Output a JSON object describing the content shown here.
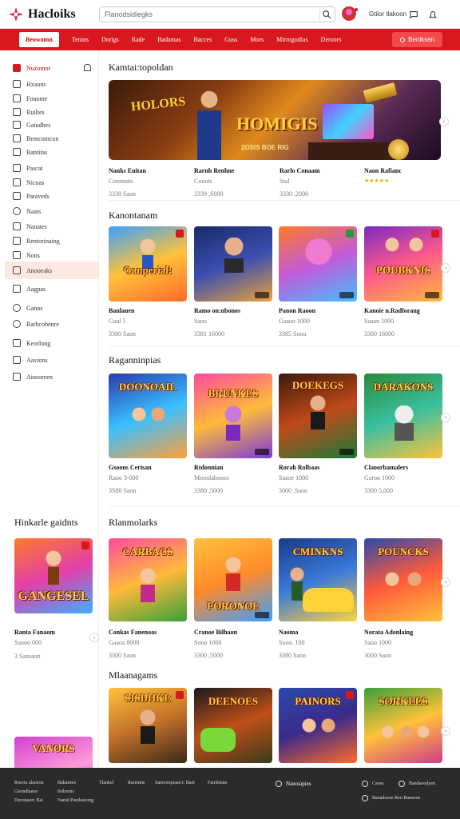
{
  "topbar": {
    "logo_text": "Hacloiks",
    "search_placeholder": "Flanodsidiegks",
    "user_name": "Gtiior tlakoon"
  },
  "nav": {
    "items": [
      "Beowomn",
      "Tenins",
      "Dorigs",
      "Rade",
      "Badamas",
      "Bacces",
      "Guss",
      "Mors",
      "Mirrogodias",
      "Deroors"
    ],
    "button_label": "Benlksen"
  },
  "sidebar": {
    "items": [
      "Nuzomor",
      "Hxaons",
      "Fouome",
      "Ruiltes",
      "Gatudhes",
      "Bemcomcon",
      "Bantitas",
      "Pascat",
      "Nicoas",
      "Paraveds",
      "Naats",
      "Nanates",
      "Rentorinaing",
      "Nons",
      "Anooeaks",
      "Aagpas",
      "Ganos",
      "Rarbcobenre",
      "Keorlong",
      "Aavions",
      "Ainsoreen"
    ]
  },
  "sections": {
    "s1": "Kamtai:topoldan",
    "s2": "Kanontanam",
    "s3": "Raganninpias",
    "s4": "Rlanmolarks",
    "s5": "Mlaanagams",
    "side": "Hinkarle gaidnts"
  },
  "banner": {
    "logo": "HOLORS",
    "title": "HOMIGIS",
    "subtitle": "2OSIS BOE RIG"
  },
  "info1": [
    {
      "t": "Nanks Enitan",
      "s": "Coronuto",
      "s2": "3338 Saon"
    },
    {
      "t": "Rarnh Renhne",
      "s": "Conots",
      "s2": "3339 ,S000"
    },
    {
      "t": "Rarlo Conaam",
      "s": "Stal",
      "s2": "3330 .2000"
    },
    {
      "t": "Naon Rafianc",
      "stars": "★★★★★"
    }
  ],
  "row2": [
    {
      "title": "Ganperial!",
      "t": "Banlauen",
      "s": "Gaul 5",
      "s2": "3380 Saon"
    },
    {
      "title": "",
      "t": "Ramo on:nbonos",
      "s": "Saoo",
      "s2": "3381 16000"
    },
    {
      "title": "",
      "t": "Panon Raoon",
      "s": "Gaaoo 1000",
      "s2": "3385 Sooo"
    },
    {
      "title": "POUBKNIS",
      "t": "Kanoie n.Radforang",
      "s": "Saaan 1000",
      "s2": "3380 16000"
    }
  ],
  "row3": [
    {
      "title": "DOONOAIL",
      "t": "Gsoons Cerisan",
      "s": "Raoo 3-000",
      "s2": "3S80 Saon"
    },
    {
      "title": "BRUNKES",
      "t": "Rtdonnian",
      "s": "Moonlabooso",
      "s2": "3380 ,5000"
    },
    {
      "title": "DOEKEGS",
      "t": "Rorah Rolbaas",
      "s": "Saaoe 1000",
      "s2": "3000 .Saon"
    },
    {
      "title": "DARAKONS",
      "t": "Claoorbamalers",
      "s": "Garon 1000",
      "s2": "3300 5,000"
    }
  ],
  "row4": [
    {
      "title": "GANGESEL",
      "t": "Ranta Fanaom",
      "s": "Sanoo 000",
      "s2": "3 Sansaon"
    },
    {
      "title": "CARBACS",
      "t": "Conkas Fanenoas",
      "s": "Gaaoa 8000",
      "s2": "3300 Saon"
    },
    {
      "title": "FORONOE",
      "t": "Cranoe Bilhaon",
      "s": "Sooo 1000",
      "s2": "3300 ,5000"
    },
    {
      "title": "CMINKNS",
      "t": "Naoma",
      "s": "Sooo. 100",
      "s2": "3380 Saon"
    },
    {
      "title": "POUNCKS",
      "t": "Norata Adonlaing",
      "s": "Saoo 1000",
      "s2": "3000 Saon"
    }
  ],
  "row5": [
    {
      "title": "VANORS"
    },
    {
      "title": "SISDHKE"
    },
    {
      "title": "DEENOES"
    },
    {
      "title": "PAINORS"
    },
    {
      "title": "SORKEES"
    }
  ],
  "footer": {
    "col1": [
      "Rmora alaneon",
      "Goondbarse",
      "Deconaon: Bai"
    ],
    "col2": [
      "Srdrorns",
      "Bakanees",
      "Nanid Paudasoong"
    ],
    "col3": [
      "Tlankel",
      "Rarenine",
      "Fairdonne"
    ],
    "col4": [
      "Sanoompiaae:t: Baet",
      "Fanolrot"
    ],
    "col5": [
      "Nanoiapies"
    ],
    "col6": [
      "Caoss",
      "Bandaoodyen"
    ],
    "col7": [
      "Baoadoeoe Reo Banaooe"
    ]
  }
}
